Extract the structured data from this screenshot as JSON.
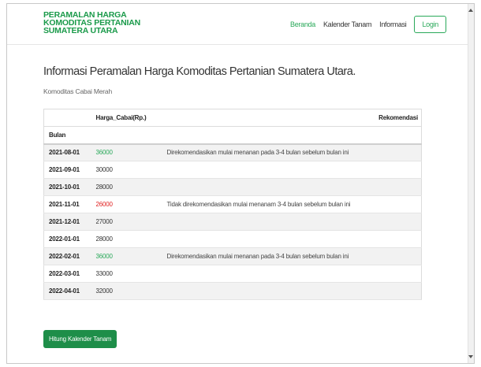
{
  "brand": {
    "line1": "PERAMALAN HARGA",
    "line2": "KOMODITAS PERTANIAN",
    "line3": "SUMATERA UTARA"
  },
  "nav": {
    "items": [
      {
        "label": "Beranda",
        "active": true
      },
      {
        "label": "Kalender Tanam",
        "active": false
      },
      {
        "label": "Informasi",
        "active": false
      }
    ],
    "login_label": "Login"
  },
  "main": {
    "heading": "Informasi Peramalan Harga Komoditas Pertanian Sumatera Utara.",
    "subtitle": "Komoditas Cabai Merah"
  },
  "table": {
    "col_harga": "Harga_Cabai(Rp.)",
    "col_rekomendasi": "Rekomendasi",
    "col_bulan": "Bulan",
    "rows": [
      {
        "bulan": "2021-08-01",
        "harga": "36000",
        "status": "green",
        "rekomendasi": "Direkomendasikan mulai menanan pada 3-4 bulan sebelum bulan ini"
      },
      {
        "bulan": "2021-09-01",
        "harga": "30000",
        "status": "normal",
        "rekomendasi": ""
      },
      {
        "bulan": "2021-10-01",
        "harga": "28000",
        "status": "normal",
        "rekomendasi": ""
      },
      {
        "bulan": "2021-11-01",
        "harga": "26000",
        "status": "red",
        "rekomendasi": "Tidak direkomendasikan mulai menanam 3-4 bulan sebelum bulan ini"
      },
      {
        "bulan": "2021-12-01",
        "harga": "27000",
        "status": "normal",
        "rekomendasi": ""
      },
      {
        "bulan": "2022-01-01",
        "harga": "28000",
        "status": "normal",
        "rekomendasi": ""
      },
      {
        "bulan": "2022-02-01",
        "harga": "36000",
        "status": "green",
        "rekomendasi": "Direkomendasikan mulai menanan pada 3-4 bulan sebelum bulan ini"
      },
      {
        "bulan": "2022-03-01",
        "harga": "33000",
        "status": "normal",
        "rekomendasi": ""
      },
      {
        "bulan": "2022-04-01",
        "harga": "32000",
        "status": "normal",
        "rekomendasi": ""
      }
    ]
  },
  "button": {
    "label": "Hitung Kalender Tanam"
  },
  "colors": {
    "brand": "#1a9a4a",
    "accent": "#2aa95a",
    "high_price": "#2aa95a",
    "low_price": "#e02020",
    "button_bg": "#1e8e49"
  }
}
